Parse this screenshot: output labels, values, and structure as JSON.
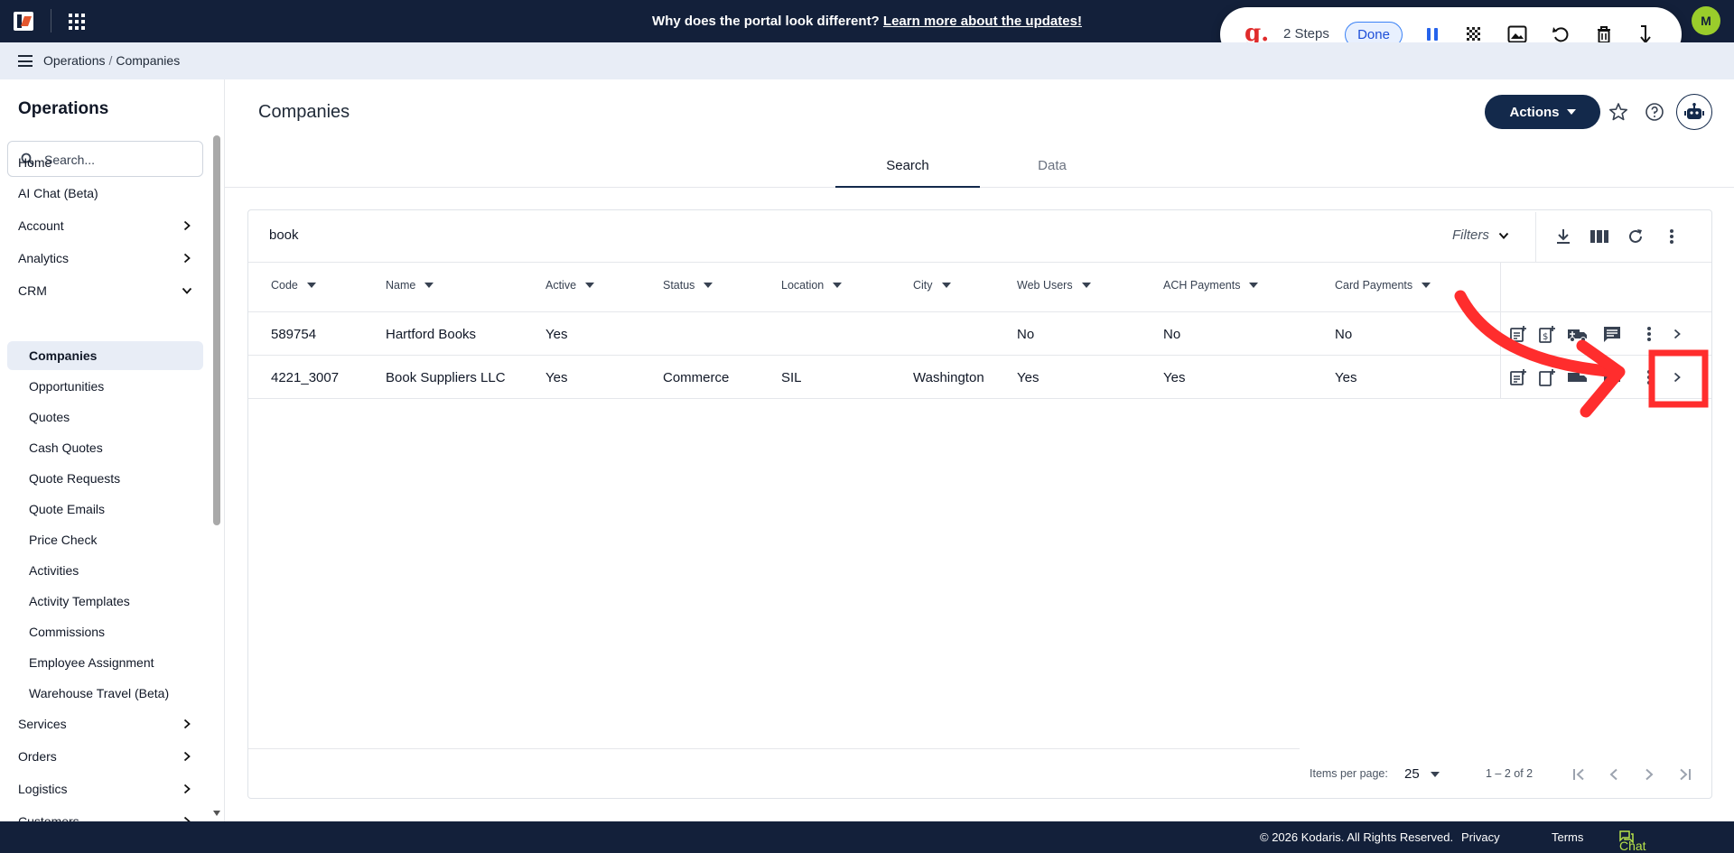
{
  "banner": {
    "text": "Why does the portal look different?",
    "link": "Learn more about the updates!"
  },
  "user": {
    "initial": "M"
  },
  "recorder": {
    "logo": "g.",
    "steps": "2 Steps",
    "done": "Done"
  },
  "breadcrumb": {
    "parent": "Operations",
    "current": "Companies"
  },
  "sidebar": {
    "title": "Operations",
    "search_placeholder": "Search...",
    "items": [
      {
        "label": "Home"
      },
      {
        "label": "AI Chat (Beta)"
      },
      {
        "label": "Account"
      },
      {
        "label": "Analytics"
      },
      {
        "label": "CRM"
      },
      {
        "label": "Companies"
      },
      {
        "label": "Opportunities"
      },
      {
        "label": "Quotes"
      },
      {
        "label": "Cash Quotes"
      },
      {
        "label": "Quote Requests"
      },
      {
        "label": "Quote Emails"
      },
      {
        "label": "Price Check"
      },
      {
        "label": "Activities"
      },
      {
        "label": "Activity Templates"
      },
      {
        "label": "Commissions"
      },
      {
        "label": "Employee Assignment"
      },
      {
        "label": "Warehouse Travel (Beta)"
      },
      {
        "label": "Services"
      },
      {
        "label": "Orders"
      },
      {
        "label": "Logistics"
      },
      {
        "label": "Customers"
      }
    ]
  },
  "page": {
    "title": "Companies",
    "actions_label": "Actions"
  },
  "tabs": [
    {
      "label": "Search"
    },
    {
      "label": "Data"
    }
  ],
  "table": {
    "search_value": "book",
    "filters_label": "Filters",
    "columns": [
      "Code",
      "Name",
      "Active",
      "Status",
      "Location",
      "City",
      "Web Users",
      "ACH Payments",
      "Card Payments"
    ],
    "rows": [
      {
        "code": "589754",
        "name": "Hartford Books",
        "active": "Yes",
        "status": "",
        "location": "",
        "city": "",
        "web_users": "No",
        "ach": "No",
        "card": "No"
      },
      {
        "code": "4221_3007",
        "name": "Book Suppliers LLC",
        "active": "Yes",
        "status": "Commerce",
        "location": "SIL",
        "city": "Washington",
        "web_users": "Yes",
        "ach": "Yes",
        "card": "Yes"
      }
    ]
  },
  "paginator": {
    "items_per_page_label": "Items per page:",
    "items_per_page": "25",
    "range": "1 – 2 of 2"
  },
  "footer": {
    "copyright": "© 2026 Kodaris. All Rights Reserved.",
    "privacy": "Privacy",
    "terms": "Terms",
    "chat": "Chat with us"
  },
  "colors": {
    "topbar": "#13203a",
    "accent": "#13294b",
    "annotation": "#ff2d2d",
    "chat": "#b7e24a"
  }
}
